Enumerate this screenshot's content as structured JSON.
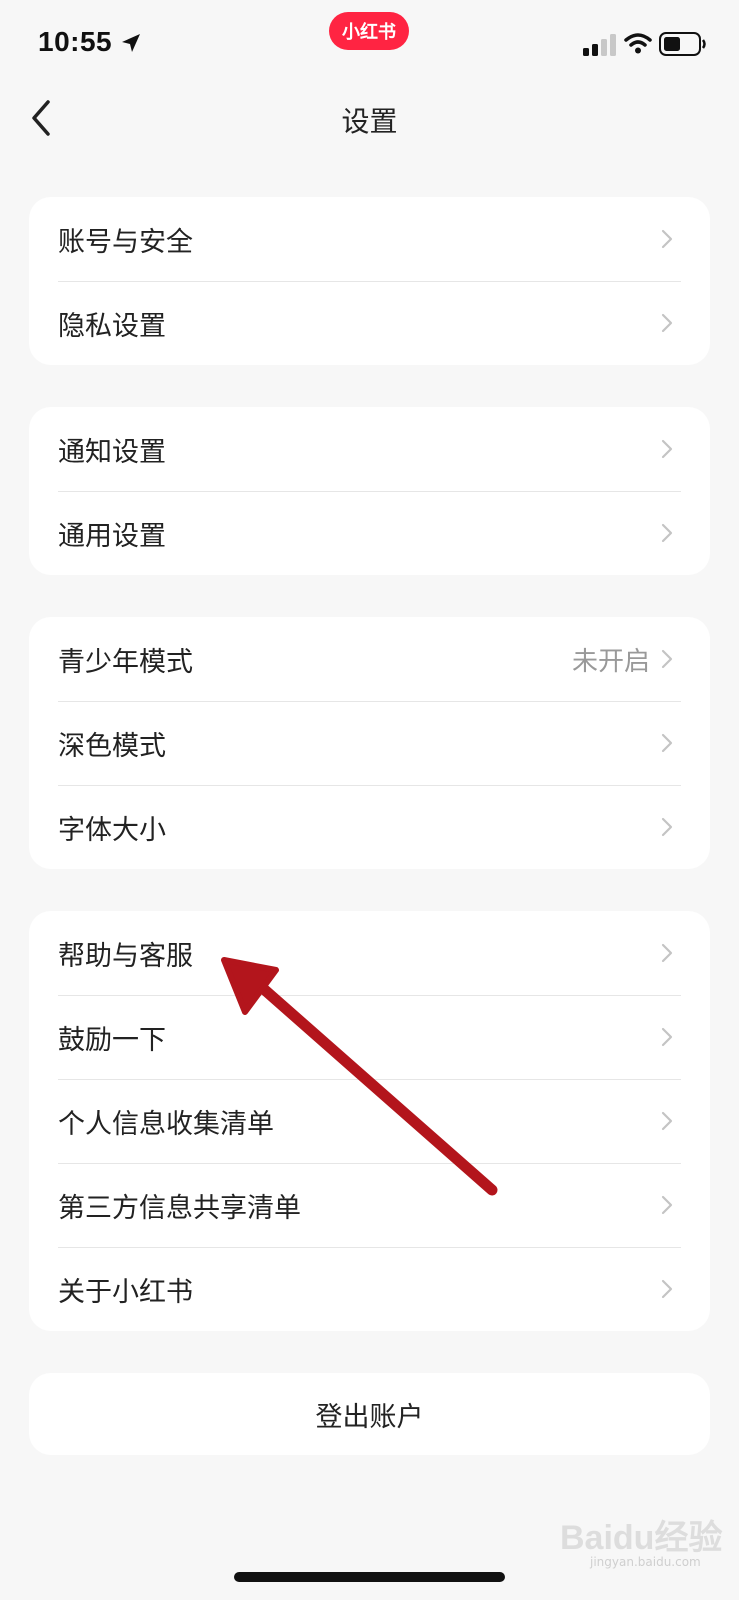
{
  "status_bar": {
    "time": "10:55",
    "app_badge": "小红书"
  },
  "nav": {
    "title": "设置"
  },
  "groups": [
    {
      "items": [
        {
          "label": "账号与安全"
        },
        {
          "label": "隐私设置"
        }
      ]
    },
    {
      "items": [
        {
          "label": "通知设置"
        },
        {
          "label": "通用设置"
        }
      ]
    },
    {
      "items": [
        {
          "label": "青少年模式",
          "value": "未开启"
        },
        {
          "label": "深色模式"
        },
        {
          "label": "字体大小"
        }
      ]
    },
    {
      "items": [
        {
          "label": "帮助与客服"
        },
        {
          "label": "鼓励一下"
        },
        {
          "label": "个人信息收集清单"
        },
        {
          "label": "第三方信息共享清单"
        },
        {
          "label": "关于小红书"
        }
      ]
    }
  ],
  "logout": {
    "label": "登出账户"
  },
  "watermark": {
    "text": "Baidu经验",
    "sub": "jingyan.baidu.com"
  },
  "colors": {
    "brand": "#ff2442",
    "annotation_arrow": "#b3151c",
    "background": "#f7f7f7"
  }
}
